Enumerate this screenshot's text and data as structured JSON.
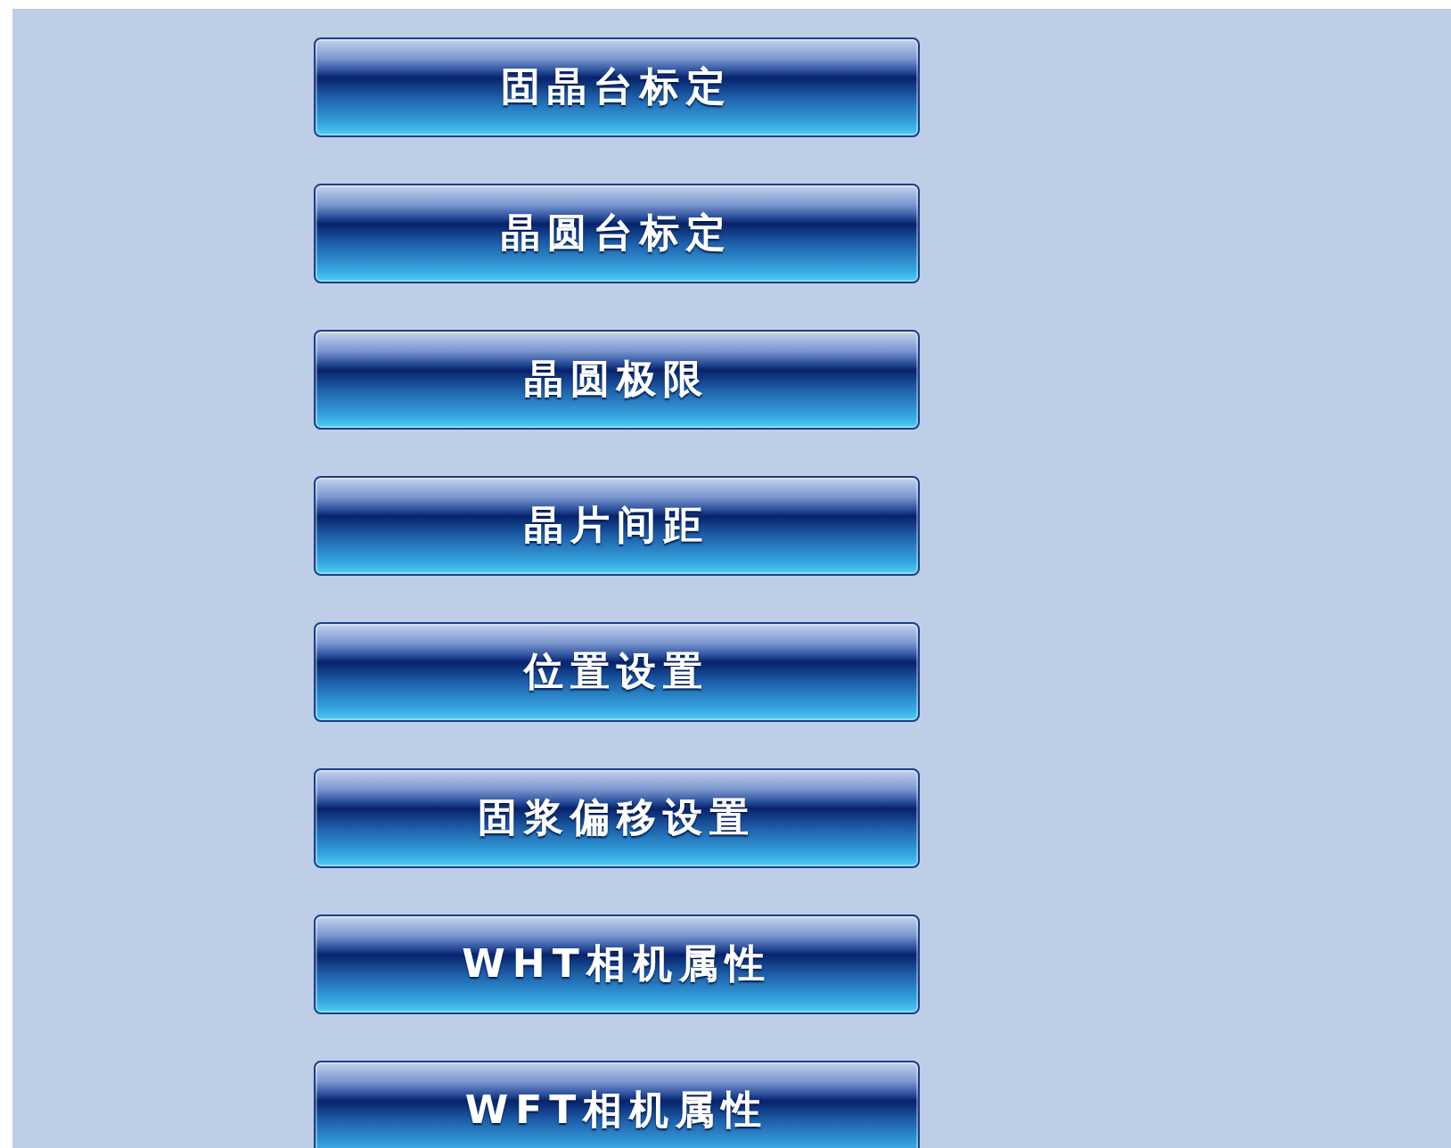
{
  "buttons": [
    {
      "label": "固晶台标定"
    },
    {
      "label": "晶圆台标定"
    },
    {
      "label": "晶圆极限"
    },
    {
      "label": "晶片间距"
    },
    {
      "label": "位置设置"
    },
    {
      "label": "固浆偏移设置"
    },
    {
      "label": "WHT相机属性"
    },
    {
      "label": "WFT相机属性"
    }
  ]
}
